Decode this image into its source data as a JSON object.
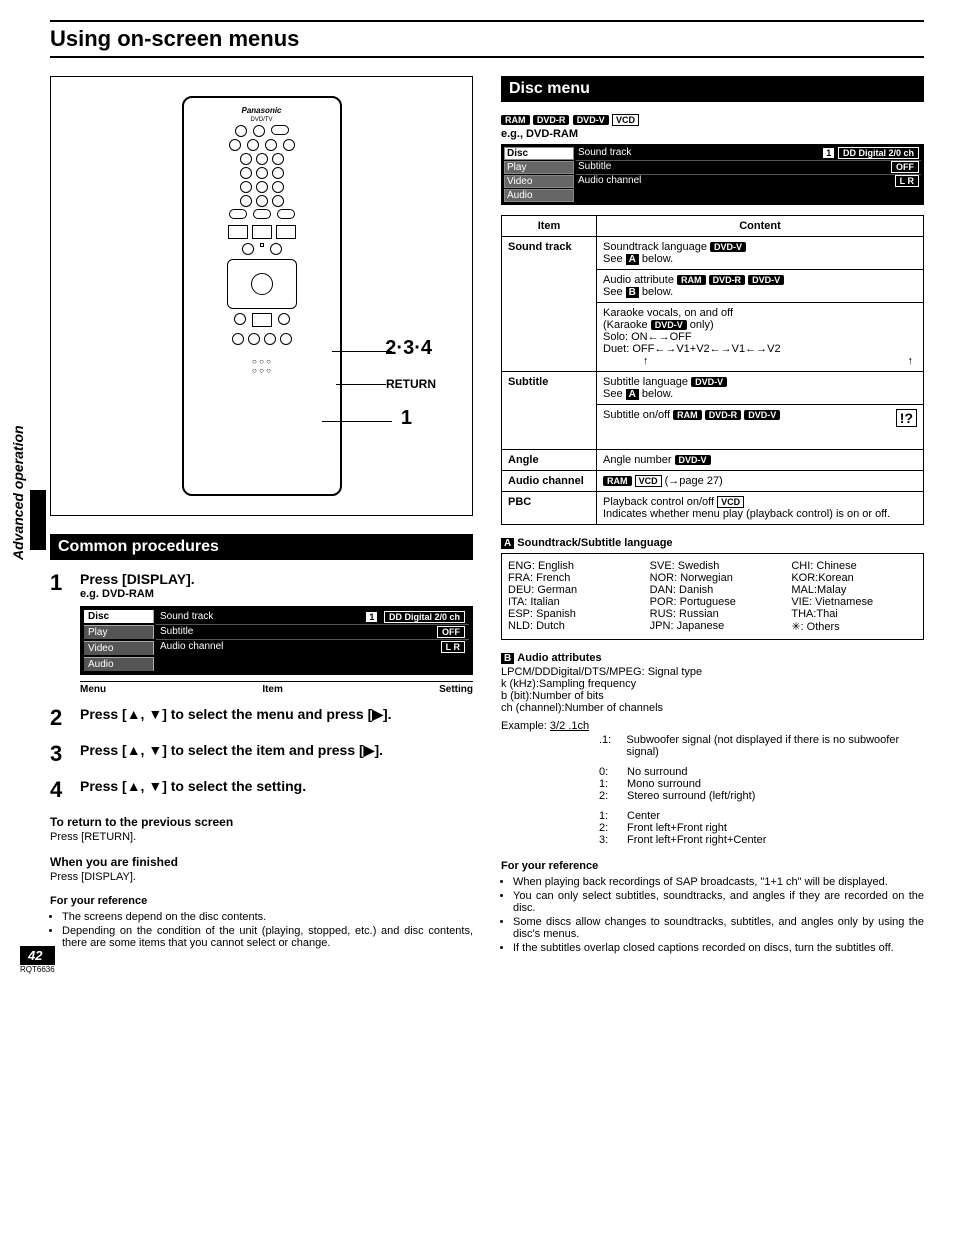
{
  "side_label": "Advanced operation",
  "page_title": "Using on-screen menus",
  "remote": {
    "callout_234": "2·3·4",
    "callout_return": "RETURN",
    "callout_1": "1",
    "brand": "Panasonic"
  },
  "common": {
    "heading": "Common procedures",
    "step1_num": "1",
    "step1_text": "Press [DISPLAY].",
    "step1_sub": "e.g. DVD-RAM",
    "osd_left": {
      "r1": "Disc",
      "r2": "Play",
      "r3": "Video",
      "r4": "Audio"
    },
    "osd_rows": [
      {
        "label": "Sound track",
        "val1": "1",
        "val2": "DD Digital  2/0 ch"
      },
      {
        "label": "Subtitle",
        "val1": "",
        "val2": "OFF"
      },
      {
        "label": "Audio channel",
        "val1": "",
        "val2": "L R"
      }
    ],
    "col_labels": {
      "a": "Menu",
      "b": "Item",
      "c": "Setting"
    },
    "step2_num": "2",
    "step2_text": "Press [▲, ▼] to select the menu and press [▶].",
    "step3_num": "3",
    "step3_text": "Press [▲, ▼] to select the item and press [▶].",
    "step4_num": "4",
    "step4_text": "Press [▲, ▼] to select the setting.",
    "return_head": "To return to the previous screen",
    "return_body": "Press [RETURN].",
    "finish_head": "When you are finished",
    "finish_body": "Press [DISPLAY].",
    "ref_head": "For your reference",
    "ref1": "The screens depend on the disc contents.",
    "ref2": "Depending on the condition of the unit (playing, stopped, etc.) and disc contents, there are some items that you cannot select or change."
  },
  "disc": {
    "heading": "Disc menu",
    "badges": {
      "ram": "RAM",
      "dvdr": "DVD-R",
      "dvdv": "DVD-V",
      "vcd": "VCD"
    },
    "eg": "e.g., DVD-RAM",
    "table_head": {
      "item": "Item",
      "content": "Content"
    },
    "rows": {
      "soundtrack": {
        "item": "Sound track",
        "c1a": "Soundtrack language ",
        "c1b": "See ",
        "c1c": " below.",
        "c2a": "Audio attribute ",
        "c2b": "See ",
        "c2c": " below.",
        "c3a": "Karaoke vocals, on and off",
        "c3b": "(Karaoke ",
        "c3c": " only)",
        "c3d": "Solo: ON←→OFF",
        "c3e": "Duet: OFF←→V1+V2←→V1←→V2"
      },
      "subtitle": {
        "item": "Subtitle",
        "c1a": "Subtitle language ",
        "c1b": "See ",
        "c1c": " below.",
        "c2a": "Subtitle on/off "
      },
      "angle": {
        "item": "Angle",
        "c1": "Angle number "
      },
      "audio": {
        "item": "Audio channel",
        "c1": " (→page 27)"
      },
      "pbc": {
        "item": "PBC",
        "c1": "Playback control on/off ",
        "c2": "Indicates whether menu play (playback control) is on or off."
      }
    },
    "lang_head": "Soundtrack/Subtitle language",
    "languages": {
      "col1": [
        "ENG: English",
        "FRA: French",
        "DEU: German",
        "ITA: Italian",
        "ESP: Spanish",
        "NLD: Dutch"
      ],
      "col2": [
        "SVE: Swedish",
        "NOR: Norwegian",
        "DAN: Danish",
        "POR: Portuguese",
        "RUS: Russian",
        "JPN: Japanese"
      ],
      "col3": [
        "CHI: Chinese",
        "KOR:Korean",
        "MAL:Malay",
        "VIE: Vietnamese",
        "THA:Thai",
        "✳: Others"
      ]
    },
    "attr_head": "Audio attributes",
    "attr_lines": [
      "LPCM/DDDigital/DTS/MPEG: Signal type",
      "k (kHz):Sampling frequency",
      "b (bit):Number of bits",
      "ch (channel):Number of channels"
    ],
    "example_label": "Example:",
    "example_val": "3/2 .1ch",
    "example_groups": [
      {
        "label": "",
        "items": [
          [
            ".1:",
            "Subwoofer signal (not displayed if there is no subwoofer signal)"
          ]
        ]
      },
      {
        "label": "",
        "items": [
          [
            "0:",
            "No surround"
          ],
          [
            "1:",
            "Mono surround"
          ],
          [
            "2:",
            "Stereo surround (left/right)"
          ]
        ]
      },
      {
        "label": "",
        "items": [
          [
            "1:",
            "Center"
          ],
          [
            "2:",
            "Front left+Front right"
          ],
          [
            "3:",
            "Front left+Front right+Center"
          ]
        ]
      }
    ],
    "ref_head": "For your reference",
    "refs": [
      "When playing back recordings of SAP broadcasts, \"1+1 ch\" will be displayed.",
      "You can only select subtitles, soundtracks, and angles if they are recorded on the disc.",
      "Some discs allow changes to soundtracks, subtitles, and angles only by using the disc's menus.",
      "If the subtitles overlap closed captions recorded on discs, turn the subtitles off."
    ]
  },
  "page_number": "42",
  "rqt": "RQT6636"
}
